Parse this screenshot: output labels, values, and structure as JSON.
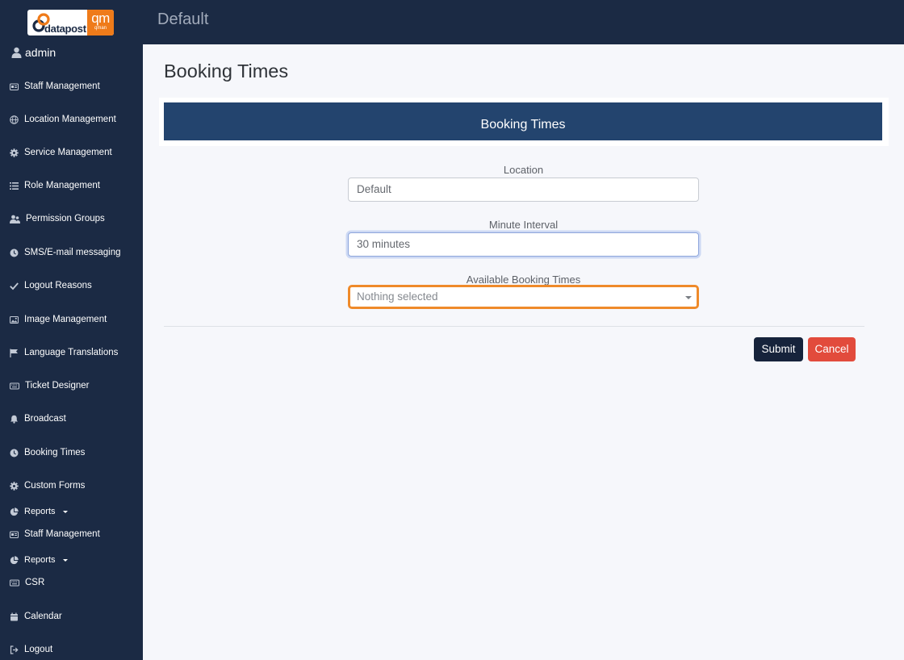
{
  "header": {
    "title": "Default"
  },
  "logo": {
    "left_text": "datapost",
    "right_big": "qm",
    "right_small": "qman"
  },
  "user": {
    "name": "admin",
    "icon": "user-icon"
  },
  "sidebar": {
    "items": [
      {
        "label": "Staff Management",
        "icon": "id-card-icon"
      },
      {
        "label": "Location Management",
        "icon": "globe-icon"
      },
      {
        "label": "Service Management",
        "icon": "gear-icon"
      },
      {
        "label": "Role Management",
        "icon": "list-icon"
      },
      {
        "label": "Permission Groups",
        "icon": "users-icon"
      },
      {
        "label": "SMS/E-mail messaging",
        "icon": "clock-icon"
      },
      {
        "label": "Logout Reasons",
        "icon": "check-icon"
      },
      {
        "label": "Image Management",
        "icon": "image-icon"
      },
      {
        "label": "Language Translations",
        "icon": "flag-icon"
      },
      {
        "label": "Ticket Designer",
        "icon": "keyboard-icon"
      },
      {
        "label": "Broadcast",
        "icon": "bell-icon"
      },
      {
        "label": "Booking Times",
        "icon": "clock-icon"
      },
      {
        "label": "Custom Forms",
        "icon": "gear-icon"
      },
      {
        "label": "Reports",
        "icon": "pie-chart-icon"
      },
      {
        "label": "Staff Management",
        "icon": "id-card-icon"
      },
      {
        "label": "Reports",
        "icon": "pie-chart-icon"
      },
      {
        "label": "CSR",
        "icon": "keyboard-icon"
      },
      {
        "label": "Calendar",
        "icon": "calendar-icon"
      },
      {
        "label": "Logout",
        "icon": "logout-icon"
      }
    ]
  },
  "main": {
    "page_title": "Booking Times",
    "card_title": "Booking Times",
    "location": {
      "label": "Location",
      "value": "Default"
    },
    "interval": {
      "label": "Minute Interval",
      "value": "30 minutes"
    },
    "times": {
      "label": "Available Booking Times",
      "value": "Nothing selected"
    },
    "submit_label": "Submit",
    "cancel_label": "Cancel"
  },
  "colors": {
    "sidebar_bg": "#1b2a44",
    "card_header_bg": "#23446e",
    "highlight": "#ef8a2a",
    "submit_bg": "#16233b",
    "cancel_bg": "#e24b3c"
  }
}
